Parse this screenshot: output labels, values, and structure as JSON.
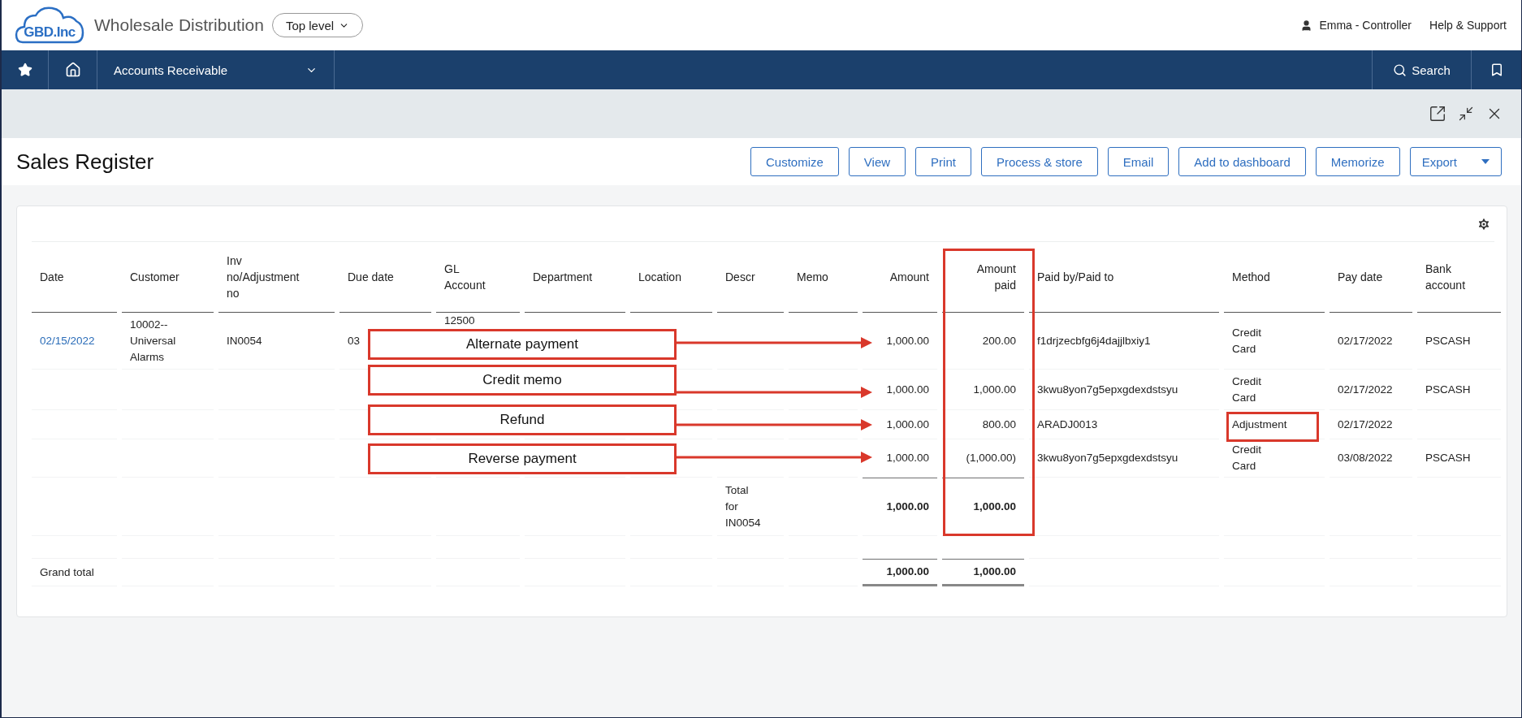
{
  "header": {
    "logo": "GBD.Inc",
    "company": "Wholesale Distribution",
    "entity": "Top level",
    "user": "Emma - Controller",
    "help": "Help & Support"
  },
  "nav": {
    "module": "Accounts Receivable",
    "search": "Search"
  },
  "page": {
    "title": "Sales Register",
    "buttons": [
      {
        "label": "Customize",
        "kind": "plain"
      },
      {
        "label": "View",
        "kind": "plain"
      },
      {
        "label": "Print",
        "kind": "plain"
      },
      {
        "label": "Process & store",
        "kind": "plain"
      },
      {
        "label": "Email",
        "kind": "plain"
      },
      {
        "label": "Add to dashboard",
        "kind": "plain"
      },
      {
        "label": "Memorize",
        "kind": "plain"
      },
      {
        "label": "Export",
        "kind": "dropdown"
      }
    ]
  },
  "table": {
    "columns": [
      "Date",
      "Customer",
      "Inv no/Adjustment no",
      "Due date",
      "GL Account",
      "Department",
      "Location",
      "Descr",
      "Memo",
      "Amount",
      "Amount paid",
      "Paid by/Paid to",
      "Method",
      "Pay date",
      "Bank account"
    ],
    "rows": [
      {
        "kind": "detail",
        "cells": [
          "02/15/2022",
          "10002-- Universal Alarms",
          "IN0054",
          "03",
          "12500",
          null,
          null,
          null,
          null,
          "1,000.00",
          "200.00",
          "f1drjzecbfg6j4dajjlbxiy1",
          "Credit Card",
          "02/17/2022",
          "PSCASH"
        ]
      },
      {
        "kind": "detail",
        "cells": [
          null,
          null,
          null,
          null,
          null,
          null,
          null,
          null,
          null,
          "1,000.00",
          "1,000.00",
          "3kwu8yon7g5epxgdexdstsyu",
          "Credit Card",
          "02/17/2022",
          "PSCASH"
        ]
      },
      {
        "kind": "detail",
        "cells": [
          null,
          null,
          null,
          null,
          null,
          null,
          null,
          null,
          null,
          "1,000.00",
          "800.00",
          "ARADJ0013",
          "Adjustment",
          "02/17/2022",
          null
        ]
      },
      {
        "kind": "detail",
        "cells": [
          null,
          null,
          null,
          null,
          null,
          null,
          null,
          null,
          null,
          "1,000.00",
          "(1,000.00)",
          "3kwu8yon7g5epxgdexdstsyu",
          "Credit Card",
          "03/08/2022",
          "PSCASH"
        ]
      },
      {
        "kind": "subtotal",
        "cells": [
          null,
          null,
          null,
          null,
          null,
          null,
          null,
          "Total for IN0054",
          null,
          "1,000.00",
          "1,000.00",
          null,
          null,
          null,
          null
        ]
      },
      {
        "kind": "grand_total",
        "cells": [
          "Grand total",
          null,
          null,
          null,
          null,
          null,
          null,
          null,
          null,
          "1,000.00",
          "1,000.00",
          null,
          null,
          null,
          null
        ]
      }
    ]
  },
  "annotations": {
    "callouts": [
      "Alternate payment",
      "Credit memo",
      "Refund",
      "Reverse payment"
    ]
  }
}
